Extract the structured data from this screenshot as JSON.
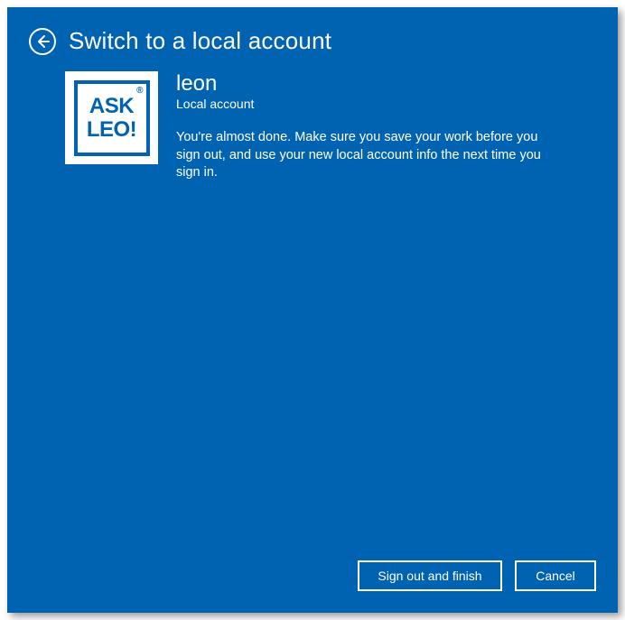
{
  "header": {
    "title": "Switch to a local account"
  },
  "avatar": {
    "line1": "ASK",
    "line2": "LEO!",
    "reg": "®"
  },
  "account": {
    "username": "leon",
    "type": "Local account",
    "description": "You're almost done. Make sure you save your work before you sign out, and use your new local account info the next time you sign in."
  },
  "buttons": {
    "primary": "Sign out and finish",
    "cancel": "Cancel"
  }
}
